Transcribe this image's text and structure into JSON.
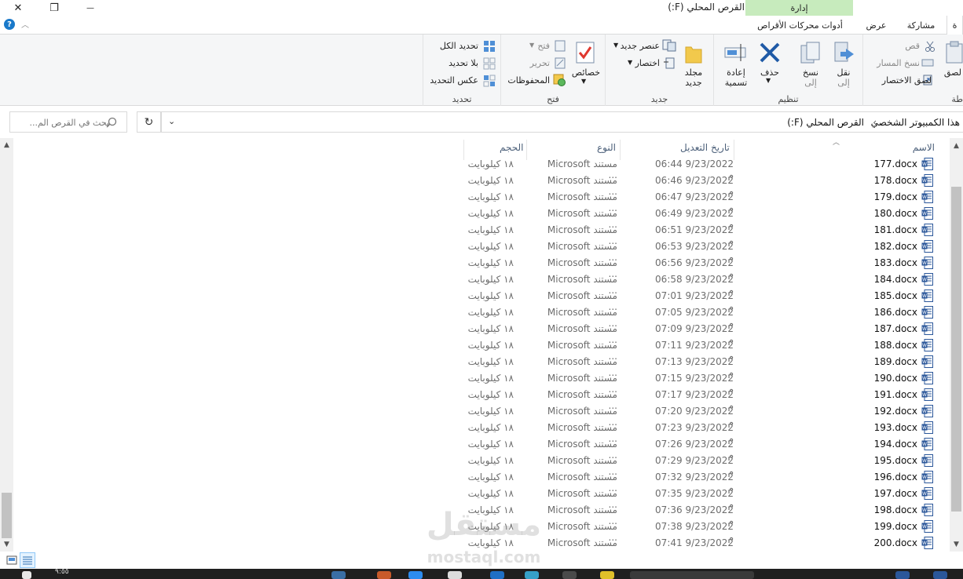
{
  "window": {
    "title": "القرص المحلي (F:)",
    "manage_tab": "إدارة",
    "close_glyph": "✕",
    "restore_glyph": "❐",
    "minimize_glyph": "—"
  },
  "tabs": {
    "share": "مشاركة",
    "view": "عرض",
    "drive_tools": "أدوات محركات الأقراص",
    "partial_first": "ة"
  },
  "ribbon": {
    "clipboard": {
      "paste": "لصق",
      "cut": "قص",
      "copy_path": "نسخ المسار",
      "paste_shortcut": "لصق الاختصار",
      "label_partial": "طة"
    },
    "organize": {
      "label": "تنظيم",
      "move_to": "نقل",
      "move_to_2": "إلى",
      "copy_to": "نسخ",
      "copy_to_2": "إلى",
      "delete": "حذف",
      "rename": "إعادة",
      "rename_2": "تسمية"
    },
    "new": {
      "label": "جديد",
      "new_folder": "مجلد",
      "new_folder_2": "جديد",
      "new_item": "عنصر جديد",
      "easy_access": "اختصار"
    },
    "open": {
      "label": "فتح",
      "properties": "خصائص",
      "open": "فتح",
      "edit": "تحرير",
      "history": "المحفوظات"
    },
    "select": {
      "label": "تحديد",
      "select_all": "تحديد الكل",
      "select_none": "بلا تحديد",
      "invert": "عكس التحديد"
    }
  },
  "address": {
    "crumb_pc": "هذا الكمبيوتر الشخصي",
    "crumb_drive": "القرص المحلي (F:)",
    "separator": "›",
    "search_placeholder": "بحث في القرص الم...",
    "refresh_glyph": "↻",
    "dropdown_glyph": "⌄"
  },
  "columns": {
    "name": "الاسم",
    "date": "تاريخ التعديل",
    "type": "النوع",
    "size": "الحجم"
  },
  "files": [
    {
      "name": "177.docx",
      "date": "9/23/2022 06:44 م",
      "type": "مستند Microsoft ...",
      "size": "١٨ كيلوبايت"
    },
    {
      "name": "178.docx",
      "date": "9/23/2022 06:46 م",
      "type": "مستند Microsoft ...",
      "size": "١٨ كيلوبايت"
    },
    {
      "name": "179.docx",
      "date": "9/23/2022 06:47 م",
      "type": "مستند Microsoft ...",
      "size": "١٨ كيلوبايت"
    },
    {
      "name": "180.docx",
      "date": "9/23/2022 06:49 م",
      "type": "مستند Microsoft ...",
      "size": "١٨ كيلوبايت"
    },
    {
      "name": "181.docx",
      "date": "9/23/2022 06:51 م",
      "type": "مستند Microsoft ...",
      "size": "١٨ كيلوبايت"
    },
    {
      "name": "182.docx",
      "date": "9/23/2022 06:53 م",
      "type": "مستند Microsoft ...",
      "size": "١٨ كيلوبايت"
    },
    {
      "name": "183.docx",
      "date": "9/23/2022 06:56 م",
      "type": "مستند Microsoft ...",
      "size": "١٨ كيلوبايت"
    },
    {
      "name": "184.docx",
      "date": "9/23/2022 06:58 م",
      "type": "مستند Microsoft ...",
      "size": "١٨ كيلوبايت"
    },
    {
      "name": "185.docx",
      "date": "9/23/2022 07:01 م",
      "type": "مستند Microsoft ...",
      "size": "١٨ كيلوبايت"
    },
    {
      "name": "186.docx",
      "date": "9/23/2022 07:05 م",
      "type": "مستند Microsoft ...",
      "size": "١٨ كيلوبايت"
    },
    {
      "name": "187.docx",
      "date": "9/23/2022 07:09 م",
      "type": "مستند Microsoft ...",
      "size": "١٨ كيلوبايت"
    },
    {
      "name": "188.docx",
      "date": "9/23/2022 07:11 م",
      "type": "مستند Microsoft ...",
      "size": "١٨ كيلوبايت"
    },
    {
      "name": "189.docx",
      "date": "9/23/2022 07:13 م",
      "type": "مستند Microsoft ...",
      "size": "١٨ كيلوبايت"
    },
    {
      "name": "190.docx",
      "date": "9/23/2022 07:15 م",
      "type": "مستند Microsoft ...",
      "size": "١٨ كيلوبايت"
    },
    {
      "name": "191.docx",
      "date": "9/23/2022 07:17 م",
      "type": "مستند Microsoft ...",
      "size": "١٨ كيلوبايت"
    },
    {
      "name": "192.docx",
      "date": "9/23/2022 07:20 م",
      "type": "مستند Microsoft ...",
      "size": "١٨ كيلوبايت"
    },
    {
      "name": "193.docx",
      "date": "9/23/2022 07:23 م",
      "type": "مستند Microsoft ...",
      "size": "١٨ كيلوبايت"
    },
    {
      "name": "194.docx",
      "date": "9/23/2022 07:26 م",
      "type": "مستند Microsoft ...",
      "size": "١٨ كيلوبايت"
    },
    {
      "name": "195.docx",
      "date": "9/23/2022 07:29 م",
      "type": "مستند Microsoft ...",
      "size": "١٨ كيلوبايت"
    },
    {
      "name": "196.docx",
      "date": "9/23/2022 07:32 م",
      "type": "مستند Microsoft ...",
      "size": "١٨ كيلوبايت"
    },
    {
      "name": "197.docx",
      "date": "9/23/2022 07:35 م",
      "type": "مستند Microsoft ...",
      "size": "١٨ كيلوبايت"
    },
    {
      "name": "198.docx",
      "date": "9/23/2022 07:36 م",
      "type": "مستند Microsoft ...",
      "size": "١٨ كيلوبايت"
    },
    {
      "name": "199.docx",
      "date": "9/23/2022 07:38 م",
      "type": "مستند Microsoft ...",
      "size": "١٨ كيلوبايت"
    },
    {
      "name": "200.docx",
      "date": "9/23/2022 07:41 م",
      "type": "مستند Microsoft ...",
      "size": "١٨ كيلوبايت"
    }
  ],
  "taskbar": {
    "time": "٩:٥٥"
  },
  "watermark": {
    "text": "مستقل",
    "sub": "mostaql.com"
  },
  "colors": {
    "accent": "#1979ca",
    "manage_tab": "#c7ebbd",
    "word_blue": "#2b579a"
  }
}
